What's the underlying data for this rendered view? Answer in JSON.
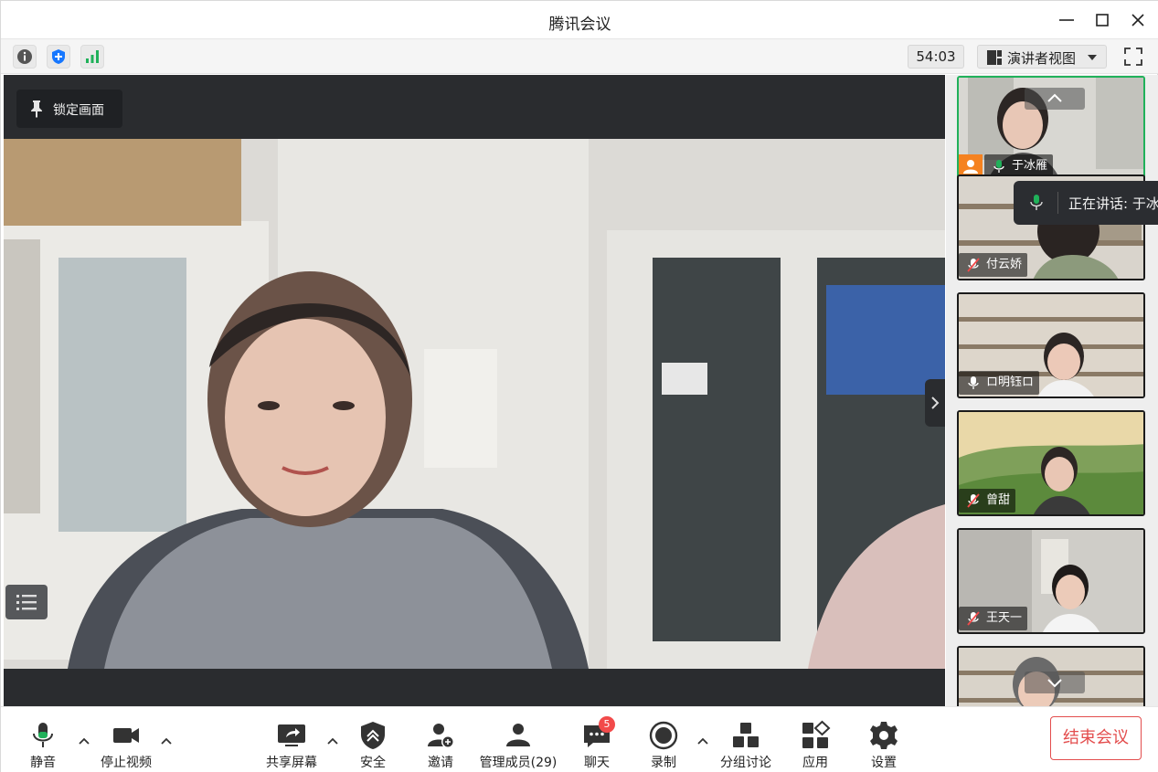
{
  "window": {
    "title": "腾讯会议"
  },
  "infobar": {
    "timer": "54:03",
    "view_mode": "演讲者视图"
  },
  "main": {
    "lock_label": "锁定画面"
  },
  "speaking_indicator": {
    "label": "正在讲话: 于冰雁"
  },
  "participants": [
    {
      "name": "于冰雁",
      "mic": "on",
      "host": true
    },
    {
      "name": "付云娇",
      "mic": "muted"
    },
    {
      "name": "ロ明钰ロ",
      "mic": "on"
    },
    {
      "name": "曾甜",
      "mic": "muted"
    },
    {
      "name": "王天一",
      "mic": "muted"
    },
    {
      "name": "",
      "mic": ""
    }
  ],
  "toolbar": {
    "mute_label": "静音",
    "video_label": "停止视频",
    "share_label": "共享屏幕",
    "security_label": "安全",
    "invite_label": "邀请",
    "members_label": "管理成员(29)",
    "chat_label": "聊天",
    "chat_badge": "5",
    "record_label": "录制",
    "breakout_label": "分组讨论",
    "apps_label": "应用",
    "settings_label": "设置",
    "end_label": "结束会议"
  },
  "colors": {
    "accent_green": "#20b15a",
    "end_red": "#e34d4d",
    "host_orange": "#f58220",
    "shield_blue": "#1677ff"
  }
}
